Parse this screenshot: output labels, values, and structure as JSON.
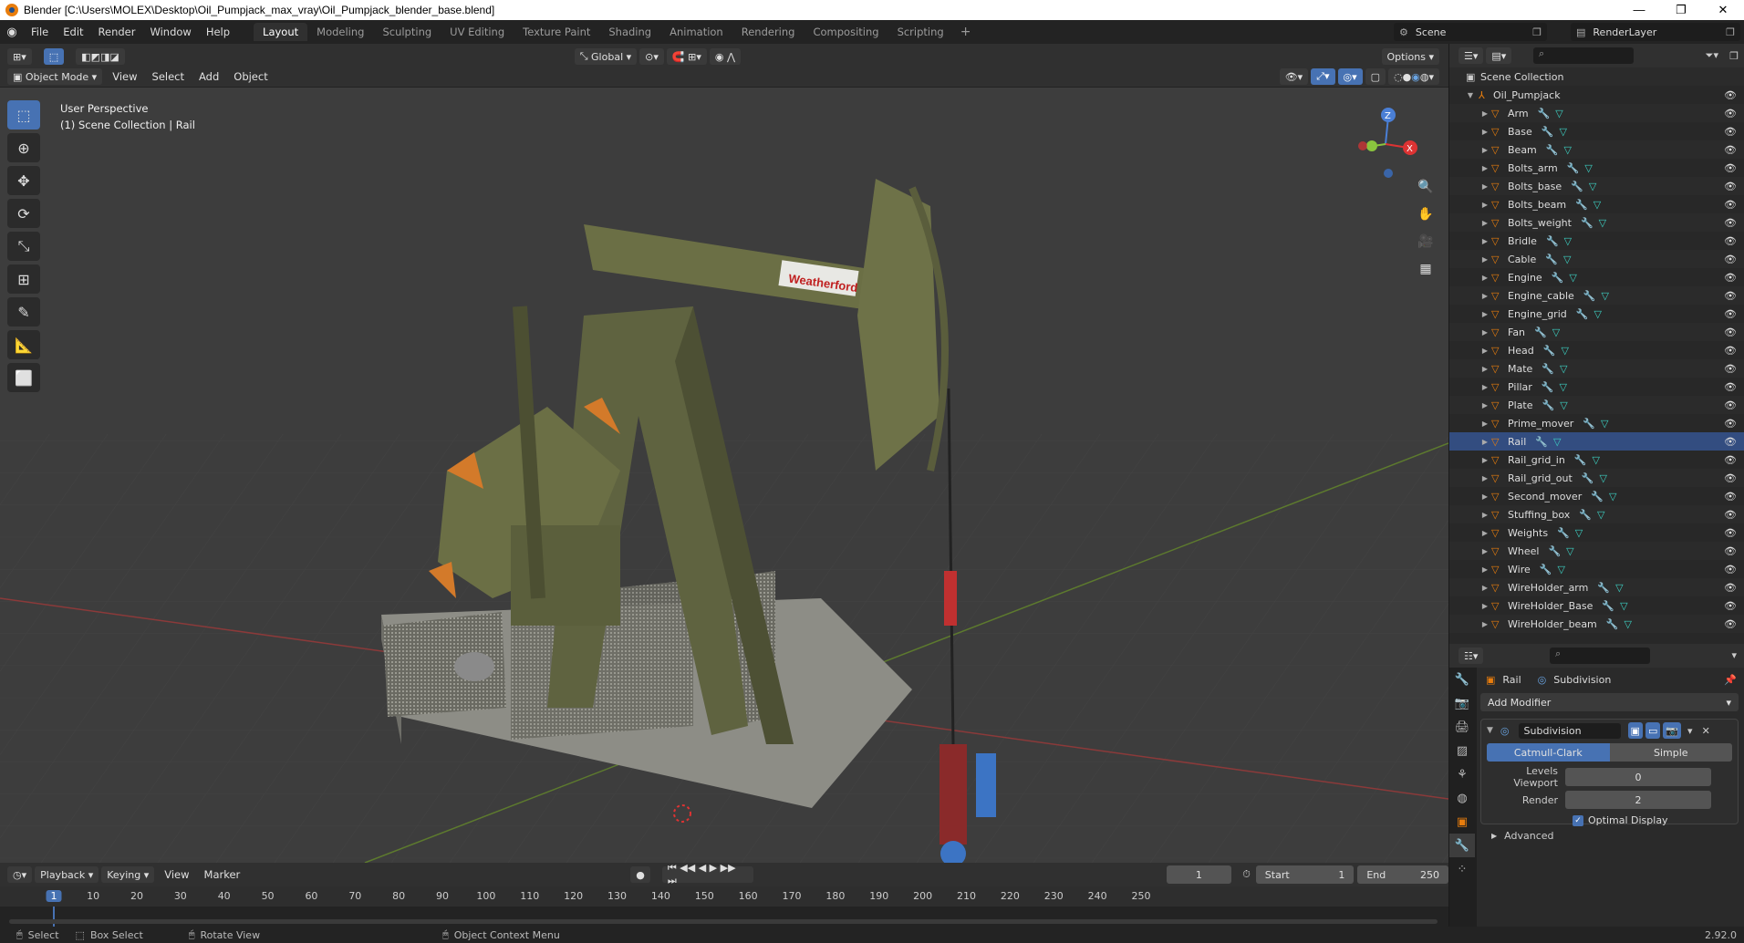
{
  "window": {
    "title": "Blender [C:\\Users\\MOLEX\\Desktop\\Oil_Pumpjack_max_vray\\Oil_Pumpjack_blender_base.blend]",
    "minimize": "—",
    "maximize": "❐",
    "close": "✕"
  },
  "menu": {
    "items": [
      "File",
      "Edit",
      "Render",
      "Window",
      "Help"
    ]
  },
  "workspaces": [
    "Layout",
    "Modeling",
    "Sculpting",
    "UV Editing",
    "Texture Paint",
    "Shading",
    "Animation",
    "Rendering",
    "Compositing",
    "Scripting"
  ],
  "scene": {
    "scene_name": "Scene",
    "render_layer": "RenderLayer"
  },
  "viewport_header": {
    "orientation": "Global",
    "options": "Options",
    "mode": "Object Mode",
    "menus": [
      "View",
      "Select",
      "Add",
      "Object"
    ]
  },
  "viewport": {
    "perspective": "User Perspective",
    "collection_info": "(1) Scene Collection | Rail",
    "brand": "Weatherford"
  },
  "gizmo": {
    "z": "Z",
    "x": "X",
    "y": "Y"
  },
  "timeline": {
    "menus": [
      "Playback",
      "Keying",
      "View",
      "Marker"
    ],
    "current_frame": "1",
    "start_label": "Start",
    "start": "1",
    "end_label": "End",
    "end": "250",
    "ruler": [
      "10",
      "20",
      "30",
      "40",
      "50",
      "60",
      "70",
      "80",
      "90",
      "100",
      "110",
      "120",
      "130",
      "140",
      "150",
      "160",
      "170",
      "180",
      "190",
      "200",
      "210",
      "220",
      "230",
      "240",
      "250"
    ],
    "playhead": "1"
  },
  "status": {
    "select": "Select",
    "box_select": "Box Select",
    "rotate": "Rotate View",
    "context": "Object Context Menu",
    "version": "2.92.0"
  },
  "outliner": {
    "root": "Scene Collection",
    "collection": "Oil_Pumpjack",
    "objects": [
      "Arm",
      "Base",
      "Beam",
      "Bolts_arm",
      "Bolts_base",
      "Bolts_beam",
      "Bolts_weight",
      "Bridle",
      "Cable",
      "Engine",
      "Engine_cable",
      "Engine_grid",
      "Fan",
      "Head",
      "Mate",
      "Pillar",
      "Plate",
      "Prime_mover",
      "Rail",
      "Rail_grid_in",
      "Rail_grid_out",
      "Second_mover",
      "Stuffing_box",
      "Weights",
      "Wheel",
      "Wire",
      "WireHolder_arm",
      "WireHolder_Base",
      "WireHolder_beam"
    ],
    "selected": "Rail"
  },
  "properties": {
    "object": "Rail",
    "modifier_type": "Subdivision",
    "add_modifier": "Add Modifier",
    "modifier_name": "Subdivision",
    "catmull": "Catmull-Clark",
    "simple": "Simple",
    "levels_label": "Levels Viewport",
    "levels_value": "0",
    "render_label": "Render",
    "render_value": "2",
    "optimal": "Optimal Display",
    "advanced": "Advanced"
  },
  "colors": {
    "accent": "#4772b3",
    "object_orange": "#e87d0d",
    "mesh_teal": "#3dd1c3"
  }
}
